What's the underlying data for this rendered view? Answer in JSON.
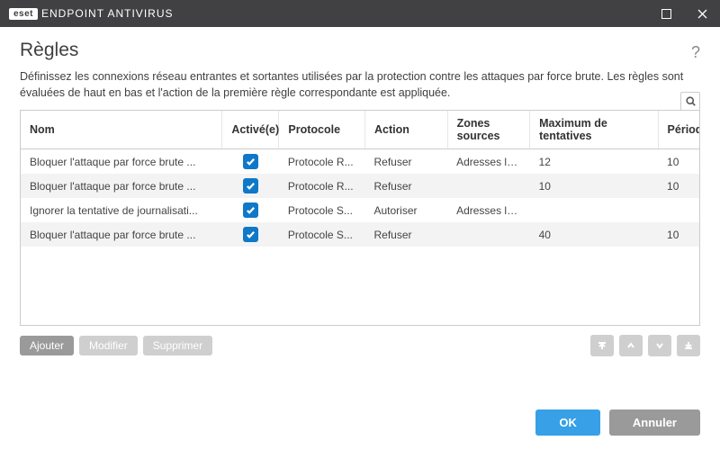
{
  "titlebar": {
    "brand_tag": "eset",
    "product": "ENDPOINT ANTIVIRUS"
  },
  "page": {
    "title": "Règles",
    "description": "Définissez les connexions réseau entrantes et sortantes utilisées par la protection contre les attaques par force brute. Les règles sont évaluées de haut en bas et l'action de la première règle correspondante est appliquée."
  },
  "table": {
    "columns": {
      "name": "Nom",
      "active": "Activé(e)",
      "protocol": "Protocole",
      "action": "Action",
      "source_zones": "Zones sources",
      "max_attempts": "Maximum de tentatives",
      "period": "Période de con"
    },
    "rows": [
      {
        "name": "Bloquer l'attaque par force brute ...",
        "active": true,
        "protocol": "Protocole R...",
        "action": "Refuser",
        "source_zones": "Adresses local...",
        "max_attempts": "12",
        "period": "10"
      },
      {
        "name": "Bloquer l'attaque par force brute ...",
        "active": true,
        "protocol": "Protocole R...",
        "action": "Refuser",
        "source_zones": "",
        "max_attempts": "10",
        "period": "10"
      },
      {
        "name": "Ignorer la tentative de journalisati...",
        "active": true,
        "protocol": "Protocole S...",
        "action": "Autoriser",
        "source_zones": "Adresses local...",
        "max_attempts": "",
        "period": ""
      },
      {
        "name": "Bloquer l'attaque par force brute ...",
        "active": true,
        "protocol": "Protocole S...",
        "action": "Refuser",
        "source_zones": "",
        "max_attempts": "40",
        "period": "10"
      }
    ]
  },
  "buttons": {
    "add": "Ajouter",
    "edit": "Modifier",
    "delete": "Supprimer",
    "ok": "OK",
    "cancel": "Annuler"
  }
}
